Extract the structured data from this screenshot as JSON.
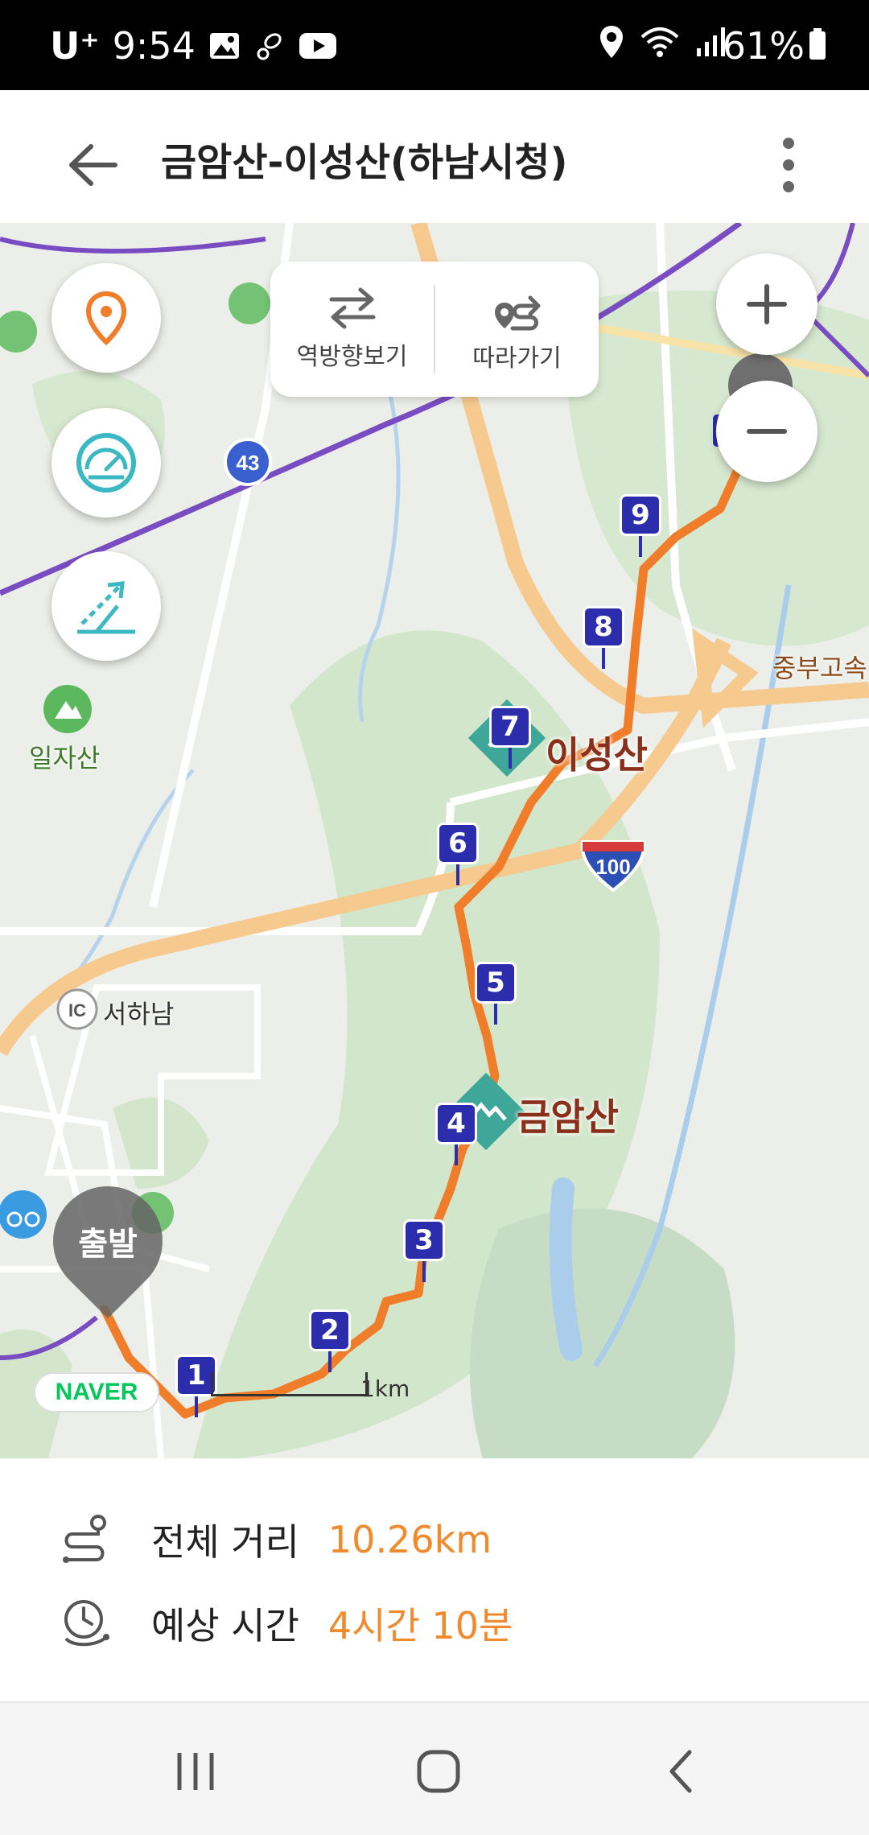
{
  "status_bar": {
    "carrier": "U⁺",
    "time": "9:54",
    "battery": "61%"
  },
  "header": {
    "title": "금암산-이성산(하남시청)"
  },
  "toolbar": {
    "reverse_label": "역방향보기",
    "follow_label": "따라가기"
  },
  "map": {
    "places": {
      "mountain_1": "이성산",
      "mountain_2": "금암산",
      "mountain_3": "일자산",
      "ic": "서하남",
      "ic_badge": "IC",
      "highway": "중부고속",
      "route_43": "43",
      "route_100": "100"
    },
    "waypoints": [
      "1",
      "2",
      "3",
      "4",
      "5",
      "6",
      "7",
      "8",
      "9"
    ],
    "start_label": "출발",
    "logo": "NAVER",
    "scale": "1km",
    "route_color": "#f07d2a",
    "waypoint_color": "#2c2dad"
  },
  "info": {
    "distance_label": "전체 거리",
    "distance_value": "10.26km",
    "time_label": "예상 시간",
    "time_value": "4시간 10분",
    "value_color": "#f08a2c"
  }
}
